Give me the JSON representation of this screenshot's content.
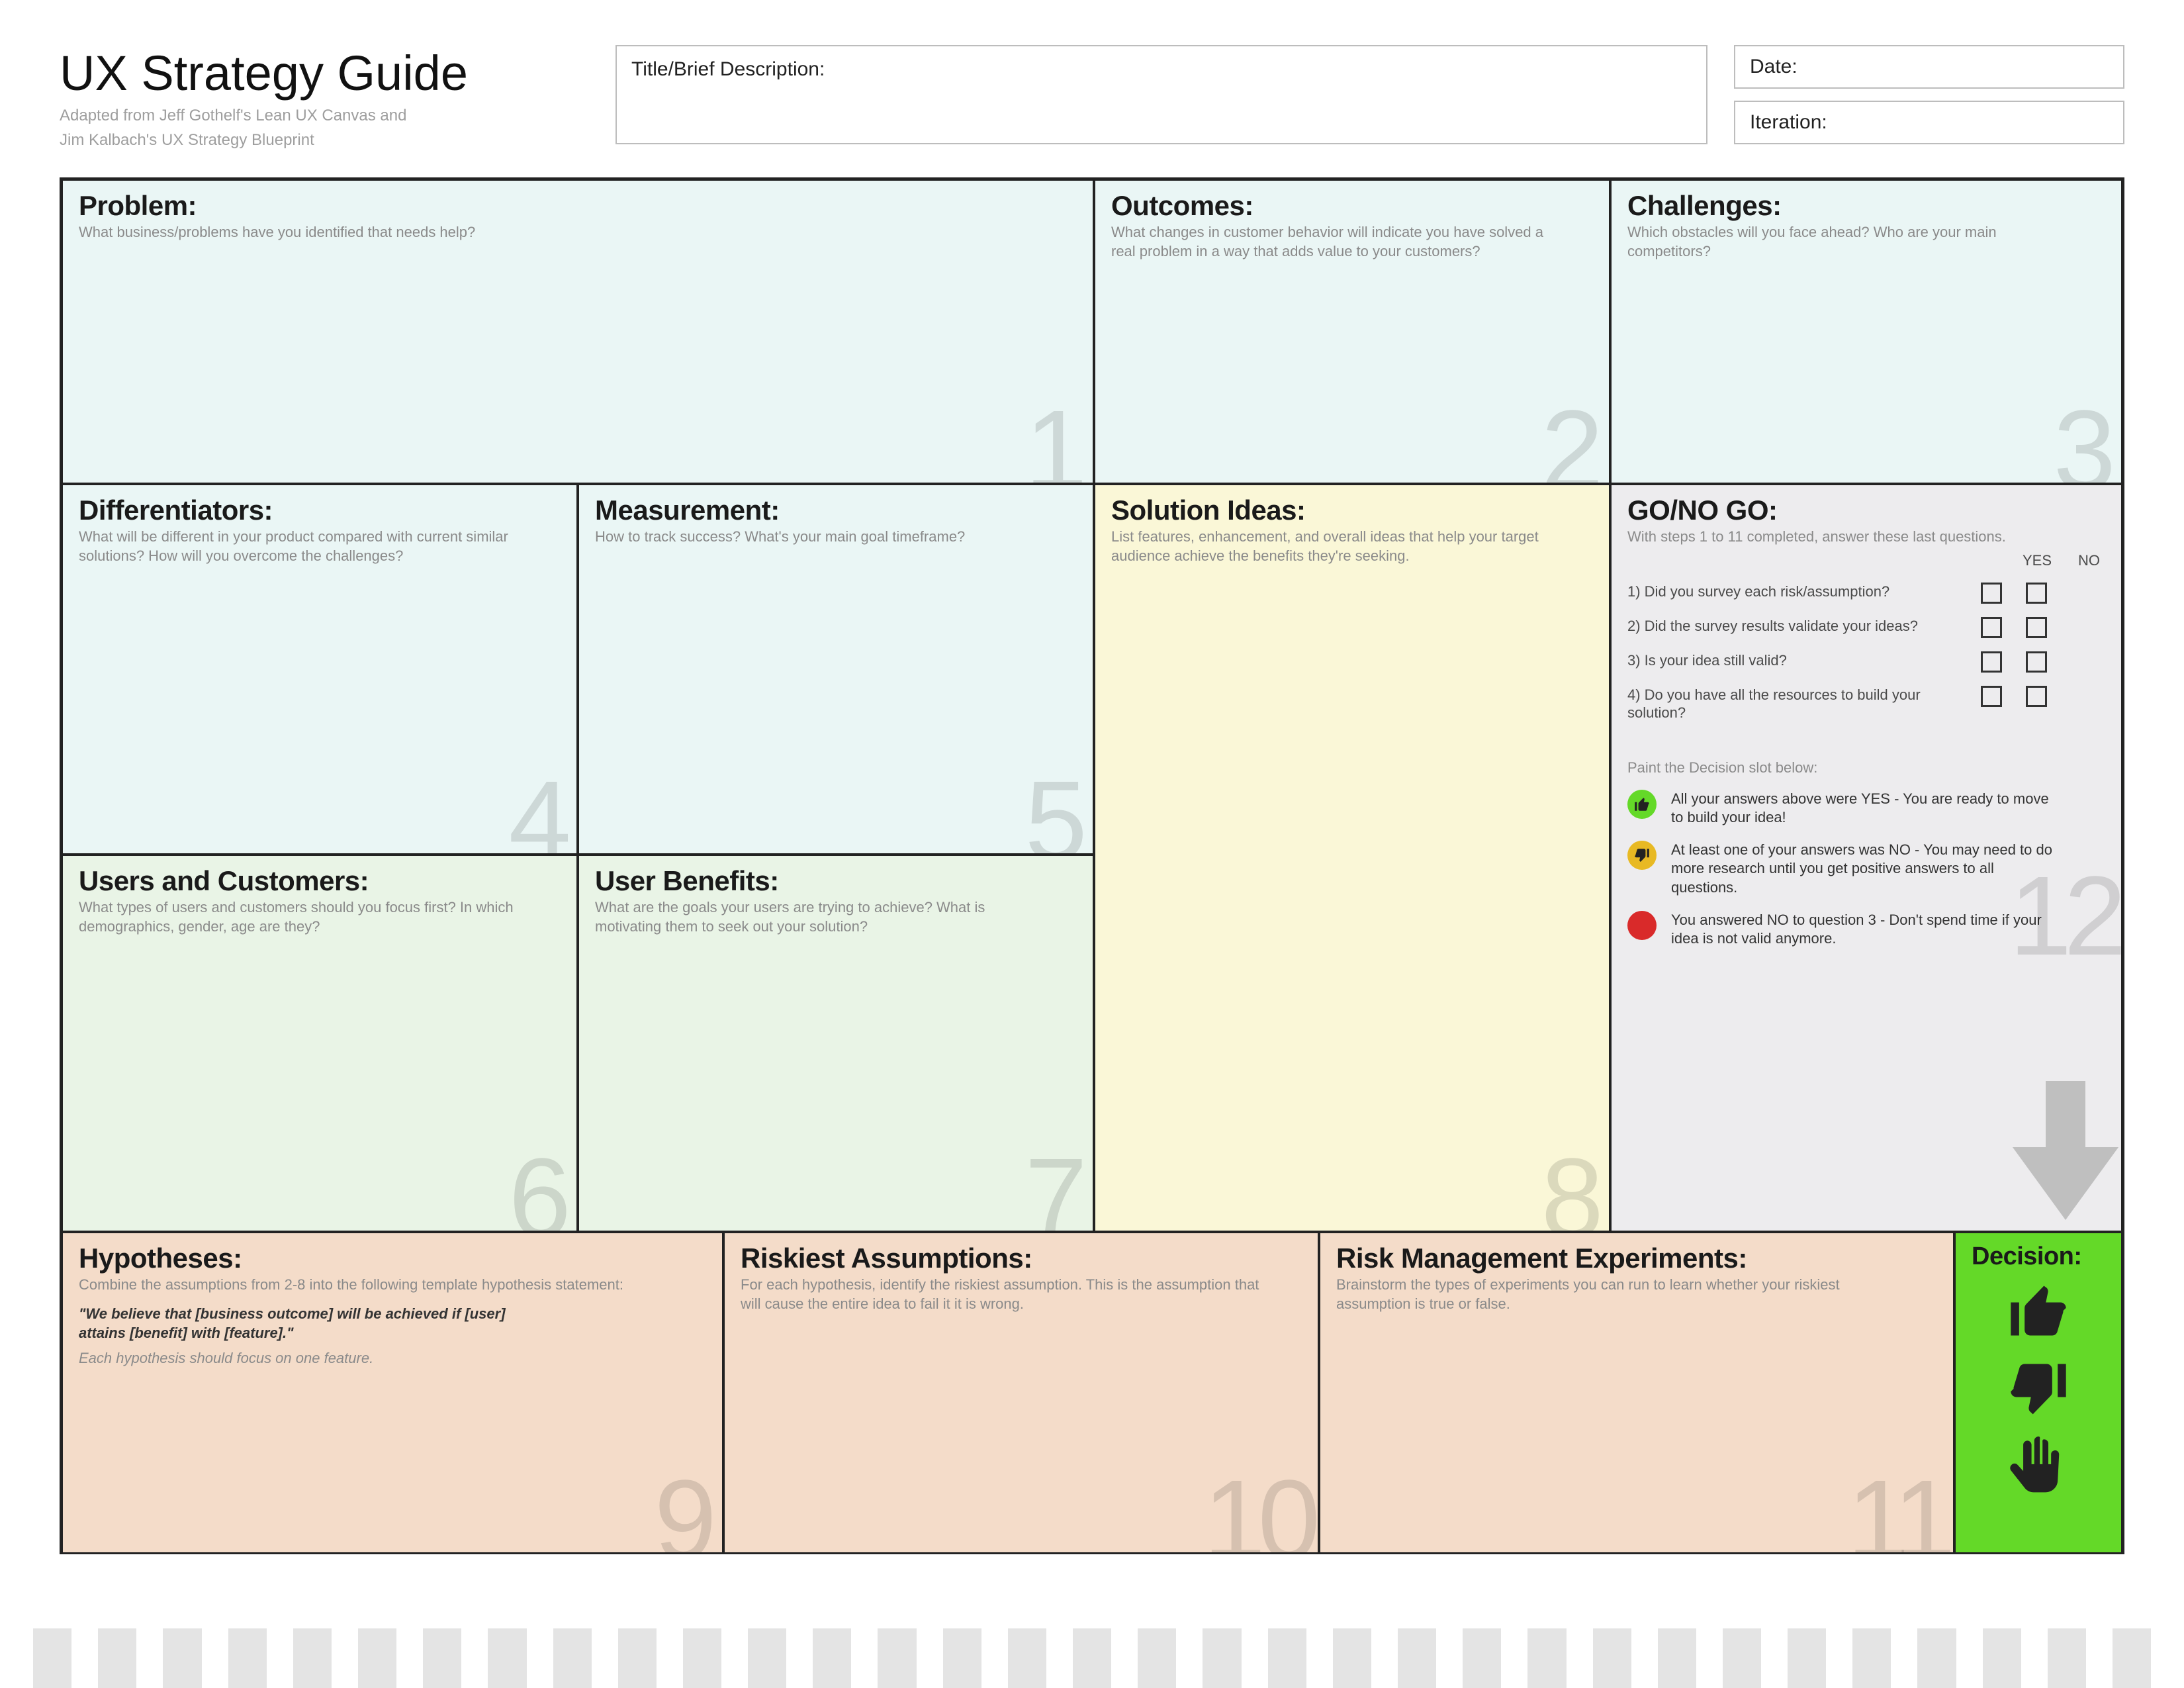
{
  "header": {
    "title": "UX Strategy Guide",
    "subtitle_1": "Adapted from Jeff Gothelf's Lean UX Canvas and",
    "subtitle_2": "Jim Kalbach's UX Strategy Blueprint",
    "title_box_label": "Title/Brief Description:",
    "date_label": "Date:",
    "iteration_label": "Iteration:"
  },
  "cells": {
    "problem": {
      "num": "1",
      "title": "Problem:",
      "sub": "What business/problems have you identified that needs help?"
    },
    "outcomes": {
      "num": "2",
      "title": "Outcomes:",
      "sub": "What changes in customer behavior will indicate you have solved a real problem in a way that adds value to your customers?"
    },
    "challenges": {
      "num": "3",
      "title": "Challenges:",
      "sub": "Which obstacles will you face ahead? Who are your main competitors?"
    },
    "diff": {
      "num": "4",
      "title": "Differentiators:",
      "sub": "What will be different in your product compared with current similar solutions? How will you overcome the challenges?"
    },
    "measure": {
      "num": "5",
      "title": "Measurement:",
      "sub": "How to track success? What's your main goal timeframe?"
    },
    "users": {
      "num": "6",
      "title": "Users and Customers:",
      "sub": "What types of users and customers should you focus first? In which demographics, gender, age are they?"
    },
    "benefits": {
      "num": "7",
      "title": "User Benefits:",
      "sub": "What are the goals your users are trying to achieve? What is motivating them to seek out your solution?"
    },
    "solution": {
      "num": "8",
      "title": "Solution Ideas:",
      "sub": "List features, enhancement, and overall ideas that help your target audience achieve the benefits they're seeking."
    },
    "gono": {
      "num": "12",
      "title": "GO/NO GO:",
      "sub": "With steps 1 to 11 completed, answer these last questions."
    },
    "hyp": {
      "num": "9",
      "title": "Hypotheses:",
      "sub": "Combine the assumptions from 2-8 into the following template hypothesis statement:"
    },
    "risk": {
      "num": "10",
      "title": "Riskiest Assumptions:",
      "sub": "For each hypothesis, identify the riskiest assumption. This is the assumption that will cause the entire idea to fail it it is wrong."
    },
    "exp": {
      "num": "11",
      "title": "Risk Management Experiments:",
      "sub": "Brainstorm the types of experiments you can run to learn whether your riskiest assumption is true or false."
    },
    "decision": {
      "title": "Decision:"
    }
  },
  "hypotheses": {
    "quote": "\"We believe that [business outcome] will be achieved if [user] attains [benefit] with [feature].\"",
    "note": "Each hypothesis should focus on one feature."
  },
  "gono": {
    "yes": "YES",
    "no": "NO",
    "q1": "1) Did you survey each risk/assumption?",
    "q2": "2) Did the survey results validate your ideas?",
    "q3": "3) Is your idea still valid?",
    "q4": "4) Do you have all the resources to build your solution?",
    "paint_label": "Paint the Decision slot below:",
    "legend_green": "All your answers above were YES - You are ready to move to build your idea!",
    "legend_amber": "At least one of your answers was NO - You may need to do more research until you get positive answers to all questions.",
    "legend_red": "You answered NO to question 3 - Don't spend time if your idea is not valid anymore."
  }
}
